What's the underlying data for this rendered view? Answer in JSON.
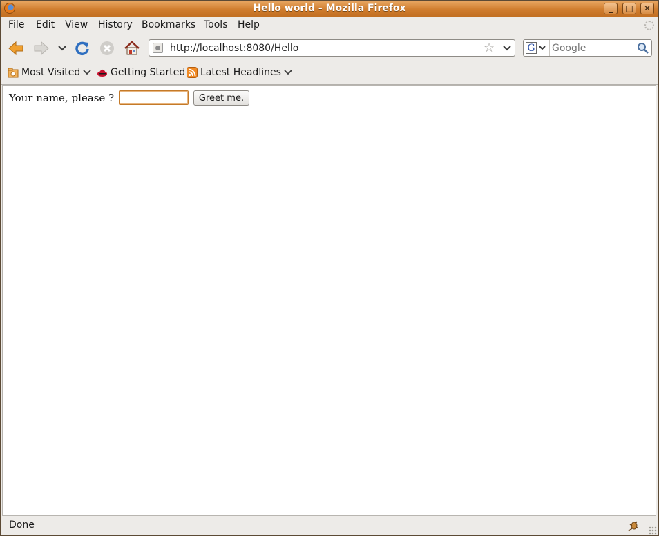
{
  "window": {
    "title": "Hello world - Mozilla Firefox"
  },
  "menu": [
    "File",
    "Edit",
    "View",
    "History",
    "Bookmarks",
    "Tools",
    "Help"
  ],
  "navigation": {
    "url": "http://localhost:8080/Hello",
    "search_placeholder": "Google",
    "search_engine_letter": "G"
  },
  "bookmarks": {
    "most_visited": "Most Visited",
    "getting_started": "Getting Started",
    "latest_headlines": "Latest Headlines"
  },
  "page": {
    "prompt": "Your name, please ?",
    "name_value": "",
    "button_label": "Greet me."
  },
  "status": {
    "text": "Done"
  },
  "colors": {
    "titlebar": "#d07d2e",
    "accent": "#e87a1b",
    "field_focus": "#c47a2a"
  },
  "icons": [
    "firefox-logo-icon",
    "minimize-icon",
    "maximize-icon",
    "close-icon",
    "back-icon",
    "forward-icon",
    "history-dropdown-icon",
    "reload-icon",
    "stop-icon",
    "home-icon",
    "site-identity-icon",
    "bookmark-star-icon",
    "url-dropdown-icon",
    "search-engine-icon",
    "search-go-icon",
    "throbber-icon",
    "folder-icon",
    "redhat-icon",
    "rss-feed-icon",
    "extension-icon",
    "resize-grip-icon"
  ]
}
